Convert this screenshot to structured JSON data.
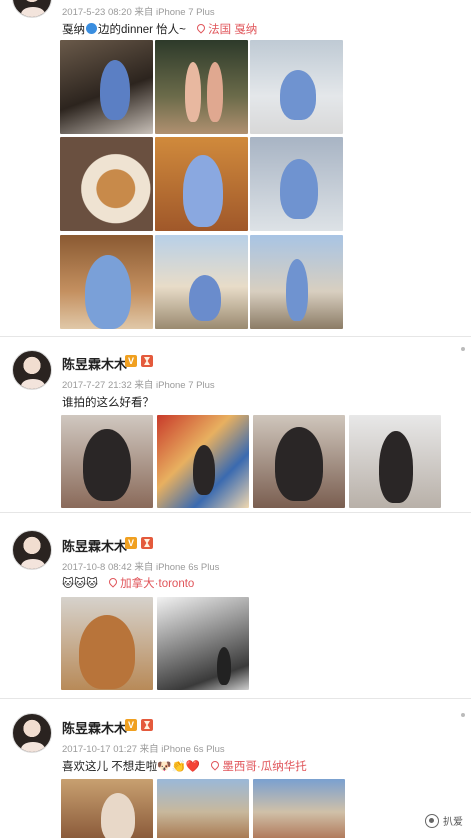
{
  "posts": [
    {
      "meta": "2017-5-23 08:20 来自 iPhone 7 Plus",
      "text": "戛纳",
      "text_rest": "边的dinner  怡人~",
      "location": "法国 戛纳"
    },
    {
      "name": "陈昱霖木木",
      "meta": "2017-7-27 21:32 来自 iPhone 7 Plus",
      "text": "谁拍的这么好看？"
    },
    {
      "name": "陈昱霖木木",
      "meta": "2017-10-8 08:42 来自 iPhone 6s Plus",
      "text": "🐱🐱🐱",
      "location": "加拿大·toronto"
    },
    {
      "name": "陈昱霖木木",
      "meta": "2017-10-17 01:27 来自 iPhone 6s Plus",
      "text": "喜欢这儿 不想走啦🐶👏❤️",
      "location": "墨西哥·瓜纳华托"
    }
  ],
  "badges": {
    "verified": "V"
  },
  "watermark": "扒爱",
  "icons": [
    "location-pin-icon",
    "verified-v-icon",
    "hourglass-icon",
    "watermark-logo-icon"
  ]
}
